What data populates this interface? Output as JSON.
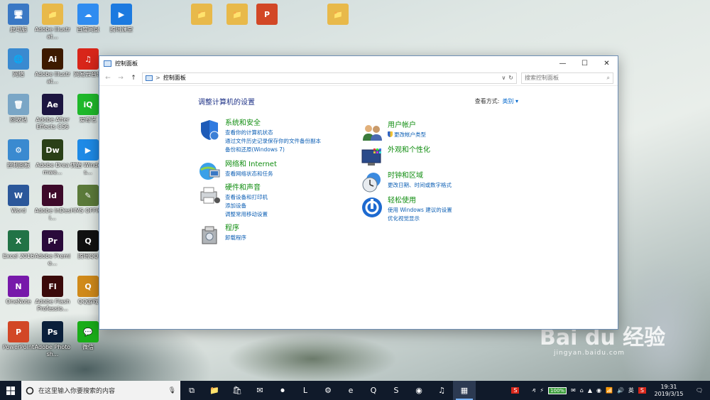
{
  "desktop": {
    "icons": [
      {
        "label": "此电脑",
        "glyph": "🖥",
        "color": "#3a78c4"
      },
      {
        "label": "Adobe Illustrat...",
        "glyph": "📁",
        "color": "#e8b94a"
      },
      {
        "label": "百度网盘",
        "glyph": "☁",
        "color": "#2f8cf0"
      },
      {
        "label": "腾讯课堂",
        "glyph": "▶",
        "color": "#1c7ae0"
      },
      {
        "label": "网络",
        "glyph": "🌐",
        "color": "#3a8ad0"
      },
      {
        "label": "Adobe Illustrat...",
        "glyph": "Ai",
        "color": "#3d1a00"
      },
      {
        "label": "网易云音乐",
        "glyph": "♫",
        "color": "#d8261a"
      },
      {
        "label": "回收站",
        "glyph": "🗑",
        "color": "#7aa6c6"
      },
      {
        "label": "Adobe After Effects CS6",
        "glyph": "Ae",
        "color": "#1c1540"
      },
      {
        "label": "爱奇艺",
        "glyph": "iQ",
        "color": "#1fb82b"
      },
      {
        "label": "控制面板",
        "glyph": "⚙",
        "color": "#3a8ad0"
      },
      {
        "label": "Adobe Dreamwe...",
        "glyph": "Dw",
        "color": "#2a4018"
      },
      {
        "label": "优酷 Windows...",
        "glyph": "▶",
        "color": "#1e8ae6"
      },
      {
        "label": "Word",
        "glyph": "W",
        "color": "#2b579a"
      },
      {
        "label": "Adobe InDesi...",
        "glyph": "Id",
        "color": "#3d0a2a"
      },
      {
        "label": "HMS OFFICE",
        "glyph": "✎",
        "color": "#5b7a3a"
      },
      {
        "label": "Excel 2016",
        "glyph": "X",
        "color": "#217346"
      },
      {
        "label": "Adobe Premie...",
        "glyph": "Pr",
        "color": "#2a0a3a"
      },
      {
        "label": "腾讯QQ",
        "glyph": "Q",
        "color": "#111111"
      },
      {
        "label": "OneNote",
        "glyph": "N",
        "color": "#7719aa"
      },
      {
        "label": "Adobe Flash Professio...",
        "glyph": "Fl",
        "color": "#3a0a0a"
      },
      {
        "label": "QQ游戏",
        "glyph": "Q",
        "color": "#d08a1a"
      },
      {
        "label": "PowerPoint",
        "glyph": "P",
        "color": "#d24726"
      },
      {
        "label": "Adobe Photosh...",
        "glyph": "Ps",
        "color": "#0a1f3a"
      },
      {
        "label": "微信",
        "glyph": "💬",
        "color": "#1aad19"
      }
    ],
    "top_icons": [
      {
        "label": "",
        "glyph": "📁",
        "color": "#e8b94a"
      },
      {
        "label": "",
        "glyph": "📁",
        "color": "#e8b94a"
      },
      {
        "label": "",
        "glyph": "P",
        "color": "#d24726"
      },
      {
        "label": "",
        "glyph": "📁",
        "color": "#e8b94a"
      }
    ]
  },
  "window": {
    "title": "控制面板",
    "minimize": "—",
    "maximize": "☐",
    "close": "✕",
    "back": "←",
    "forward": "→",
    "up": "↑",
    "breadcrumb_sep": ">",
    "breadcrumb": "控制面板",
    "dropdown": "∨",
    "refresh": "↻",
    "search_placeholder": "搜索控制面板",
    "search_icon": "⌕",
    "heading": "调整计算机的设置",
    "view_by_label": "查看方式:",
    "view_by_value": "类别 ▾",
    "categories": [
      {
        "title": "系统和安全",
        "links": [
          "查看你的计算机状态",
          "通过文件历史记录保存你的文件备份副本",
          "备份和还原(Windows 7)"
        ]
      },
      {
        "title": "网络和 Internet",
        "links": [
          "查看网络状态和任务"
        ]
      },
      {
        "title": "硬件和声音",
        "links": [
          "查看设备和打印机",
          "添加设备",
          "调整常用移动设置"
        ]
      },
      {
        "title": "程序",
        "links": [
          "卸载程序"
        ]
      },
      {
        "title": "用户帐户",
        "links": [
          "更改帐户类型"
        ]
      },
      {
        "title": "外观和个性化",
        "links": []
      },
      {
        "title": "时钟和区域",
        "links": [
          "更改日期、时间或数字格式"
        ]
      },
      {
        "title": "轻松使用",
        "links": [
          "使用 Windows 建议的设置",
          "优化视觉显示"
        ]
      }
    ]
  },
  "taskbar": {
    "search_placeholder": "在这里输入你要搜索的内容",
    "mic_icon": "🎙",
    "apps": [
      "⧉",
      "📁",
      "🛍",
      "✉",
      "⏺",
      "L",
      "⚙",
      "e",
      "Q",
      "S",
      "◉",
      "♫",
      "▦"
    ],
    "tray_left": "S",
    "tray_icons": [
      "ዳ",
      "⚡"
    ],
    "battery": "100%",
    "tray_icons2": [
      "✉",
      "⌂",
      "▲",
      "◉",
      "📶",
      "🔊",
      "英",
      "S"
    ],
    "time": "19:31",
    "date": "2019/3/15",
    "notif": "🗨"
  },
  "watermark": {
    "brand": "Bai du 经验",
    "url": "jingyan.baidu.com"
  }
}
